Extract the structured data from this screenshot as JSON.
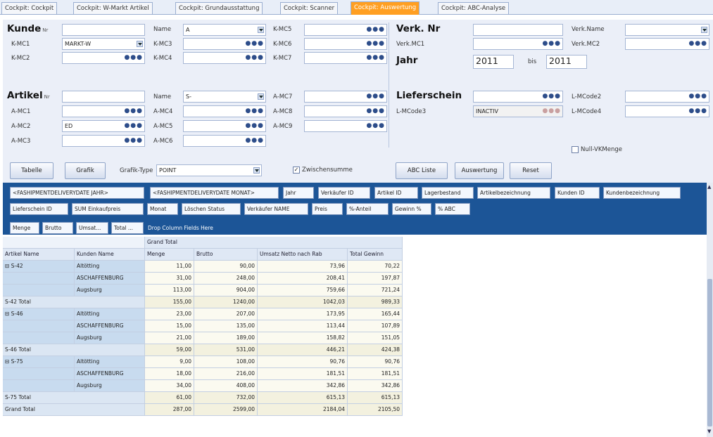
{
  "tabs": [
    "Cockpit: Cockpit",
    "Cockpit: W-Markt Artikel",
    "Cockpit: Grundausstattung",
    "Cockpit: Scanner",
    "Cockpit: Auswertung",
    "Cockpit: ABC-Analyse"
  ],
  "kunde": {
    "title": "Kunde",
    "nr": "Nr",
    "kmc1_label": "K-MC1",
    "kmc1_value": "MARKT-W",
    "kmc2_label": "K-MC2",
    "name_label": "Name",
    "name_value": "A",
    "kmc3": "K-MC3",
    "kmc4": "K-MC4",
    "kmc5": "K-MC5",
    "kmc6": "K-MC6",
    "kmc7": "K-MC7"
  },
  "artikel": {
    "title": "Artikel",
    "nr": "Nr",
    "amc1": "A-MC1",
    "amc2": "A-MC2",
    "amc2_value": "ED",
    "amc3": "A-MC3",
    "name_label": "Name",
    "name_value": "S-",
    "amc4": "A-MC4",
    "amc5": "A-MC5",
    "amc6": "A-MC6",
    "amc7": "A-MC7",
    "amc8": "A-MC8",
    "amc9": "A-MC9"
  },
  "verk": {
    "title": "Verk. Nr",
    "mc1": "Verk.MC1",
    "name_label": "Verk.Name",
    "mc2": "Verk.MC2"
  },
  "jahr": {
    "label": "Jahr",
    "from": "2011",
    "bis": "bis",
    "to": "2011"
  },
  "lieferschein": {
    "title": "Lieferschein",
    "lmcode3": "L-MCode3",
    "lmcode3_value": "INACTIV",
    "lmcode2": "L-MCode2",
    "lmcode4": "L-MCode4"
  },
  "null_vk": "Null-VKMenge",
  "buttons": {
    "tabelle": "Tabelle",
    "grafik": "Grafik",
    "grafik_type_label": "Grafik-Type",
    "grafik_type_value": "POINT",
    "zwischensumme": "Zwischensumme",
    "abc_liste": "ABC Liste",
    "auswertung": "Auswertung",
    "reset": "Reset"
  },
  "pivot": {
    "filter_row1": [
      "<FASHIPMENTDELIVERYDATE JAHR>",
      "<FASHIPMENTDELIVERYDATE MONAT>",
      "Jahr",
      "Verkäufer ID",
      "Artikel ID",
      "Lagerbestand",
      "Artikelbezeichnung",
      "Kunden ID",
      "Kundenbezeichnung"
    ],
    "filter_row2": [
      "Lieferschein ID",
      "SUM Einkaufpreis",
      "Monat",
      "Löschen Status",
      "Verkäufer NAME",
      "Preis",
      "%-Anteil",
      "Gewinn %",
      "% ABC"
    ],
    "data_fields": [
      "Menge",
      "Brutto",
      "Umsat...",
      "Total ..."
    ],
    "drop_text": "Drop Column Fields Here",
    "grand_total": "Grand Total",
    "row_headers": [
      "Artikel Name",
      "Kunden Name"
    ],
    "col_headers": [
      "Menge",
      "Brutto",
      "Umsatz Netto nach Rab",
      "Total Gewinn"
    ],
    "rows": [
      {
        "art": "S-42",
        "kunde": "Altötting",
        "v": [
          "11,00",
          "90,00",
          "73,96",
          "70,22"
        ]
      },
      {
        "art": "",
        "kunde": "ASCHAFFENBURG",
        "v": [
          "31,00",
          "248,00",
          "208,41",
          "197,87"
        ]
      },
      {
        "art": "",
        "kunde": "Augsburg",
        "v": [
          "113,00",
          "904,00",
          "759,66",
          "721,24"
        ]
      },
      {
        "art": "S-42 Total",
        "kunde": "",
        "v": [
          "155,00",
          "1240,00",
          "1042,03",
          "989,33"
        ],
        "total": true
      },
      {
        "art": "S-46",
        "kunde": "Altötting",
        "v": [
          "23,00",
          "207,00",
          "173,95",
          "165,44"
        ]
      },
      {
        "art": "",
        "kunde": "ASCHAFFENBURG",
        "v": [
          "15,00",
          "135,00",
          "113,44",
          "107,89"
        ]
      },
      {
        "art": "",
        "kunde": "Augsburg",
        "v": [
          "21,00",
          "189,00",
          "158,82",
          "151,05"
        ]
      },
      {
        "art": "S-46 Total",
        "kunde": "",
        "v": [
          "59,00",
          "531,00",
          "446,21",
          "424,38"
        ],
        "total": true
      },
      {
        "art": "S-75",
        "kunde": "Altötting",
        "v": [
          "9,00",
          "108,00",
          "90,76",
          "90,76"
        ]
      },
      {
        "art": "",
        "kunde": "ASCHAFFENBURG",
        "v": [
          "18,00",
          "216,00",
          "181,51",
          "181,51"
        ]
      },
      {
        "art": "",
        "kunde": "Augsburg",
        "v": [
          "34,00",
          "408,00",
          "342,86",
          "342,86"
        ]
      },
      {
        "art": "S-75 Total",
        "kunde": "",
        "v": [
          "61,00",
          "732,00",
          "615,13",
          "615,13"
        ],
        "total": true
      },
      {
        "art": "Grand Total",
        "kunde": "",
        "v": [
          "287,00",
          "2599,00",
          "2184,04",
          "2105,50"
        ],
        "total": true
      }
    ]
  }
}
